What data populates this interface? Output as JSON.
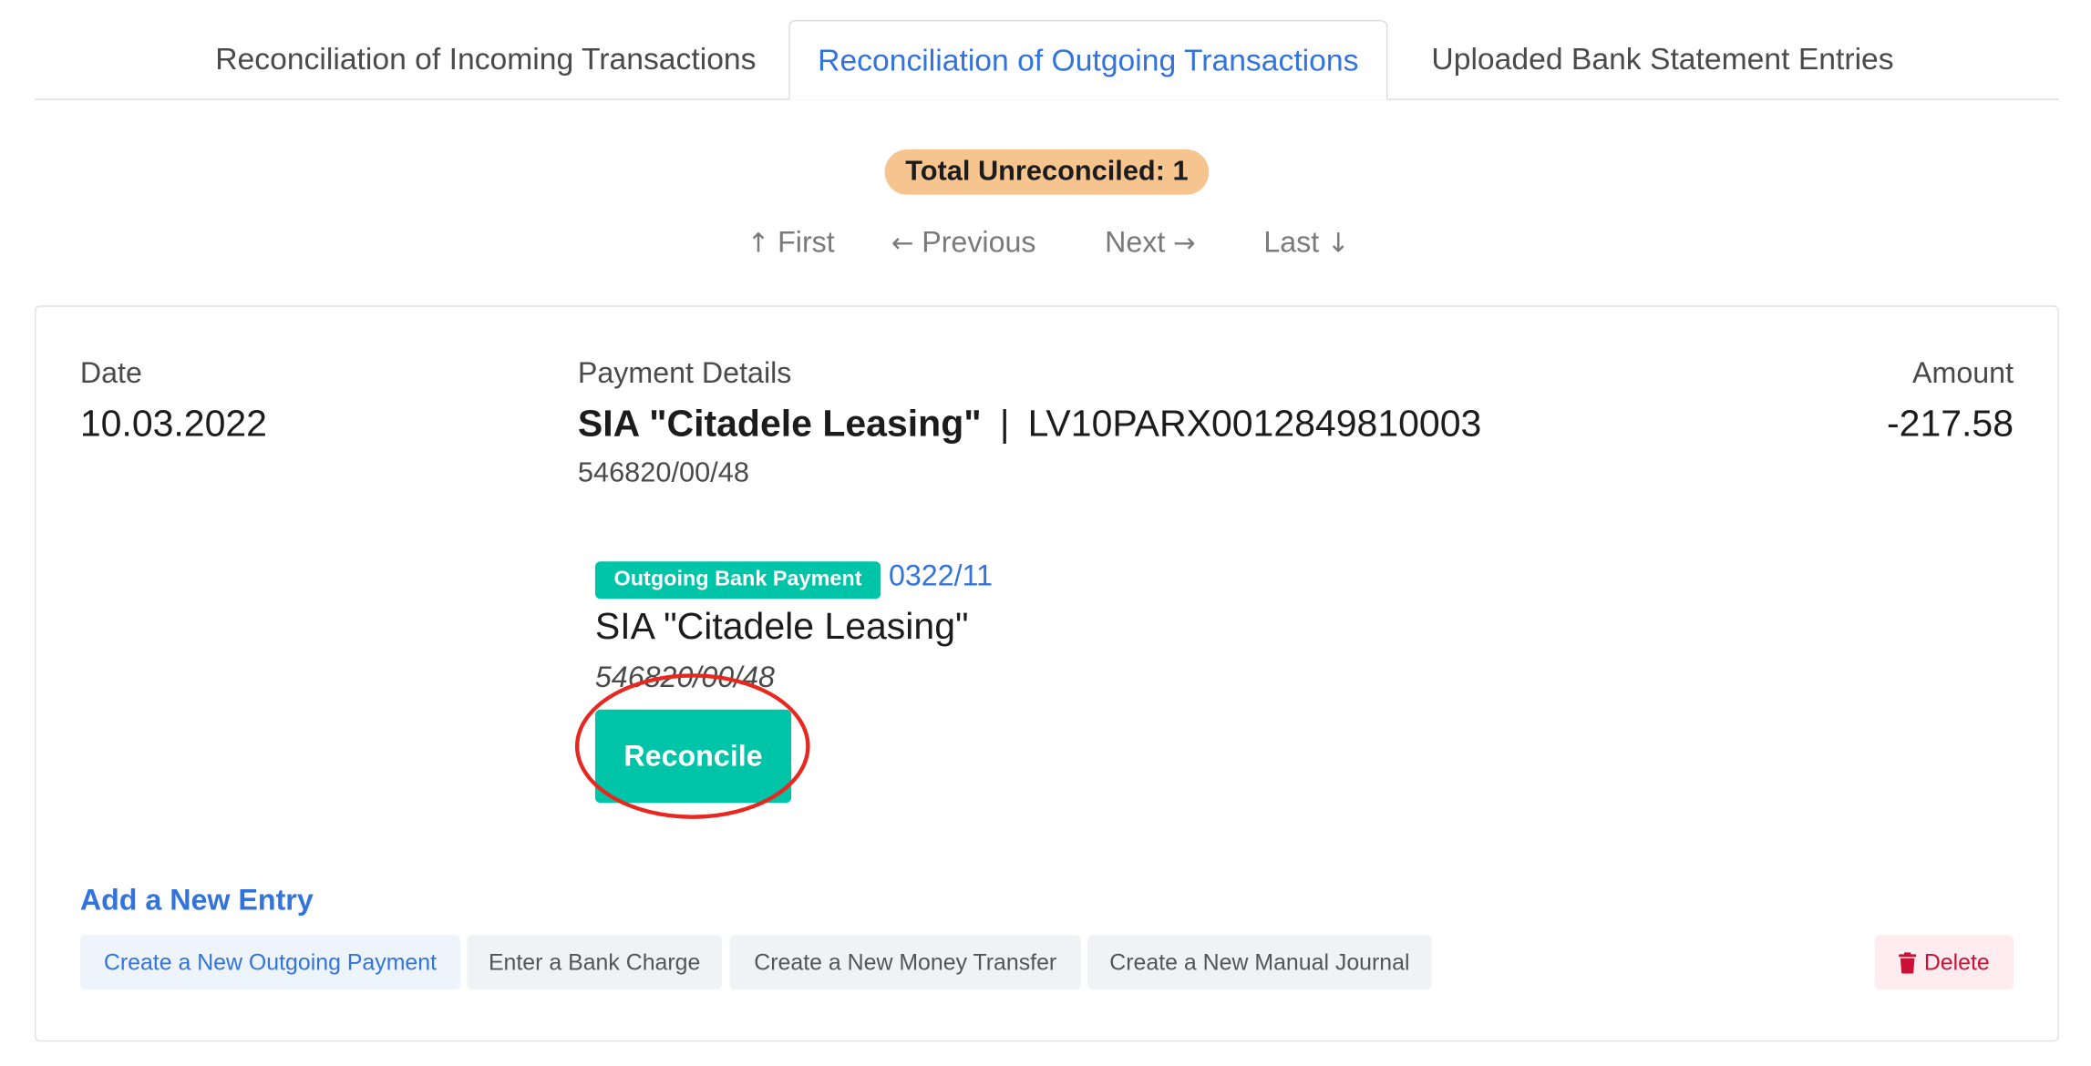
{
  "tabs": [
    {
      "label": "Reconciliation of Incoming Transactions",
      "active": false
    },
    {
      "label": "Reconciliation of Outgoing Transactions",
      "active": true
    },
    {
      "label": "Uploaded Bank Statement Entries",
      "active": false
    }
  ],
  "summary": {
    "total_unreconciled": "Total Unreconciled: 1"
  },
  "pager": {
    "first": "First",
    "previous": "Previous",
    "next": "Next",
    "last": "Last"
  },
  "transaction": {
    "date_label": "Date",
    "date": "10.03.2022",
    "details_label": "Payment Details",
    "payee": "SIA \"Citadele Leasing\"",
    "separator": "|",
    "iban": "LV10PARX0012849810003",
    "reference": "546820/00/48",
    "amount_label": "Amount",
    "amount": "-217.58"
  },
  "match": {
    "type_tag": "Outgoing Bank Payment",
    "document_number": "0322/11",
    "payee": "SIA \"Citadele Leasing\"",
    "reference": "546820/00/48",
    "reconcile_label": "Reconcile"
  },
  "add_entry": {
    "title": "Add a New Entry",
    "buttons": [
      "Create a New Outgoing Payment",
      "Enter a Bank Charge",
      "Create a New Money Transfer",
      "Create a New Manual Journal"
    ],
    "delete_label": "Delete"
  },
  "colors": {
    "link": "#3273dc",
    "primary": "#00c4a7",
    "warning_badge": "#f6c48e",
    "danger": "#cc0f35",
    "annotation": "#e8281f"
  },
  "icons": [
    "arrow-up-icon",
    "arrow-left-icon",
    "arrow-right-icon",
    "arrow-down-icon",
    "trash-icon"
  ]
}
